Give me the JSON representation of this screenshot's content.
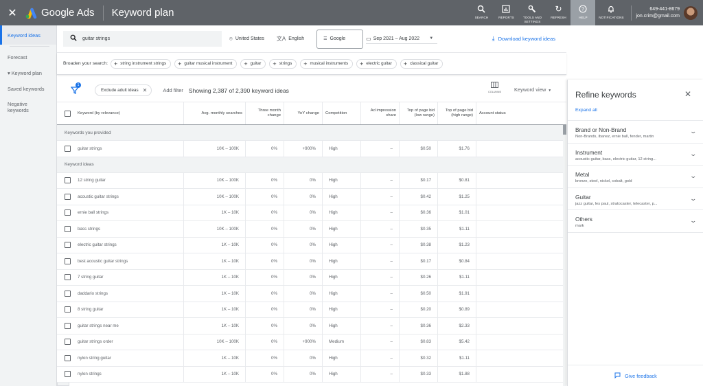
{
  "topbar": {
    "app_name": "Google Ads",
    "page_title": "Keyword plan",
    "close_glyph": "✕",
    "buttons": [
      {
        "label": "SEARCH",
        "icon": "🔍"
      },
      {
        "label": "REPORTS",
        "icon": "▥"
      },
      {
        "label": "TOOLS AND SETTINGS",
        "icon": "🔧"
      },
      {
        "label": "REFRESH",
        "icon": "↻"
      },
      {
        "label": "HELP",
        "icon": "?"
      },
      {
        "label": "NOTIFICATIONS",
        "icon": "🔔"
      }
    ],
    "account": {
      "phone": "649-441-8679",
      "email": "jon.crim@gmail.com"
    }
  },
  "sidebar": {
    "items": [
      {
        "label": "Keyword ideas",
        "active": true
      },
      {
        "label": "Forecast"
      },
      {
        "label": "▾ Keyword plan"
      },
      {
        "label": "Saved keywords"
      },
      {
        "label": "Negative keywords"
      }
    ],
    "collapse_glyph": "◂"
  },
  "search": {
    "query": "guitar strings",
    "location": "United States",
    "language": "English",
    "network": "Google",
    "date_range": "Sep 2021 – Aug 2022",
    "download_label": "Download keyword ideas"
  },
  "broaden": {
    "label": "Broaden your search:",
    "chips": [
      "string instrument strings",
      "guitar musical instrument",
      "guitar",
      "strings",
      "musical instruments",
      "electric guitar",
      "classical guitar"
    ]
  },
  "toolbar": {
    "filter_count": "1",
    "exclude_chip": "Exclude adult ideas",
    "add_filter": "Add filter",
    "showing": "Showing 2,387 of 2,390 keyword ideas",
    "columns_label": "COLUMNS",
    "keyword_view": "Keyword view"
  },
  "table": {
    "headers": [
      "Keyword (by relevance)",
      "Avg. monthly searches",
      "Three month change",
      "YoY change",
      "Competition",
      "Ad impression share",
      "Top of page bid (low range)",
      "Top of page bid (high range)",
      "Account status"
    ],
    "section_provided": "Keywords you provided",
    "provided_rows": [
      [
        "guitar strings",
        "10K – 100K",
        "0%",
        "+900%",
        "High",
        "–",
        "$0.50",
        "$1.76",
        ""
      ]
    ],
    "section_ideas": "Keyword ideas",
    "idea_rows": [
      [
        "12 string guitar",
        "10K – 100K",
        "0%",
        "0%",
        "High",
        "–",
        "$0.17",
        "$0.81",
        ""
      ],
      [
        "acoustic guitar strings",
        "10K – 100K",
        "0%",
        "0%",
        "High",
        "–",
        "$0.42",
        "$1.25",
        ""
      ],
      [
        "ernie ball strings",
        "1K – 10K",
        "0%",
        "0%",
        "High",
        "–",
        "$0.36",
        "$1.01",
        ""
      ],
      [
        "bass strings",
        "10K – 100K",
        "0%",
        "0%",
        "High",
        "–",
        "$0.35",
        "$1.11",
        ""
      ],
      [
        "electric guitar strings",
        "1K – 10K",
        "0%",
        "0%",
        "High",
        "–",
        "$0.38",
        "$1.23",
        ""
      ],
      [
        "best acoustic guitar strings",
        "1K – 10K",
        "0%",
        "0%",
        "High",
        "–",
        "$0.17",
        "$0.84",
        ""
      ],
      [
        "7 string guitar",
        "1K – 10K",
        "0%",
        "0%",
        "High",
        "–",
        "$0.26",
        "$1.11",
        ""
      ],
      [
        "daddario strings",
        "1K – 10K",
        "0%",
        "0%",
        "High",
        "–",
        "$0.50",
        "$1.91",
        ""
      ],
      [
        "8 string guitar",
        "1K – 10K",
        "0%",
        "0%",
        "High",
        "–",
        "$0.20",
        "$0.89",
        ""
      ],
      [
        "guitar strings near me",
        "1K – 10K",
        "0%",
        "0%",
        "High",
        "–",
        "$0.36",
        "$2.33",
        ""
      ],
      [
        "guitar strings order",
        "10K – 100K",
        "0%",
        "+900%",
        "Medium",
        "–",
        "$0.83",
        "$5.42",
        ""
      ],
      [
        "nylon string guitar",
        "1K – 10K",
        "0%",
        "0%",
        "High",
        "–",
        "$0.32",
        "$1.11",
        ""
      ],
      [
        "nylon strings",
        "1K – 10K",
        "0%",
        "0%",
        "High",
        "–",
        "$0.33",
        "$1.88",
        ""
      ]
    ]
  },
  "refine": {
    "title": "Refine keywords",
    "expand_all": "Expand all",
    "groups": [
      {
        "name": "Brand or Non-Brand",
        "sub": "Non-Brands, ibanez, ernie ball, fender, martin"
      },
      {
        "name": "Instrument",
        "sub": "acoustic guitar, bass, electric guitar, 12 string..."
      },
      {
        "name": "Metal",
        "sub": "bronze, steel, nickel, cobalt, gold"
      },
      {
        "name": "Guitar",
        "sub": "jazz guitar, les paul, stratocaster, telecaster, p..."
      },
      {
        "name": "Others",
        "sub": "mark"
      }
    ],
    "feedback": "Give feedback"
  },
  "colors": {
    "accent": "#1a73e8",
    "topbar": "#5f6368",
    "sidebar": "#f1f3f4"
  }
}
